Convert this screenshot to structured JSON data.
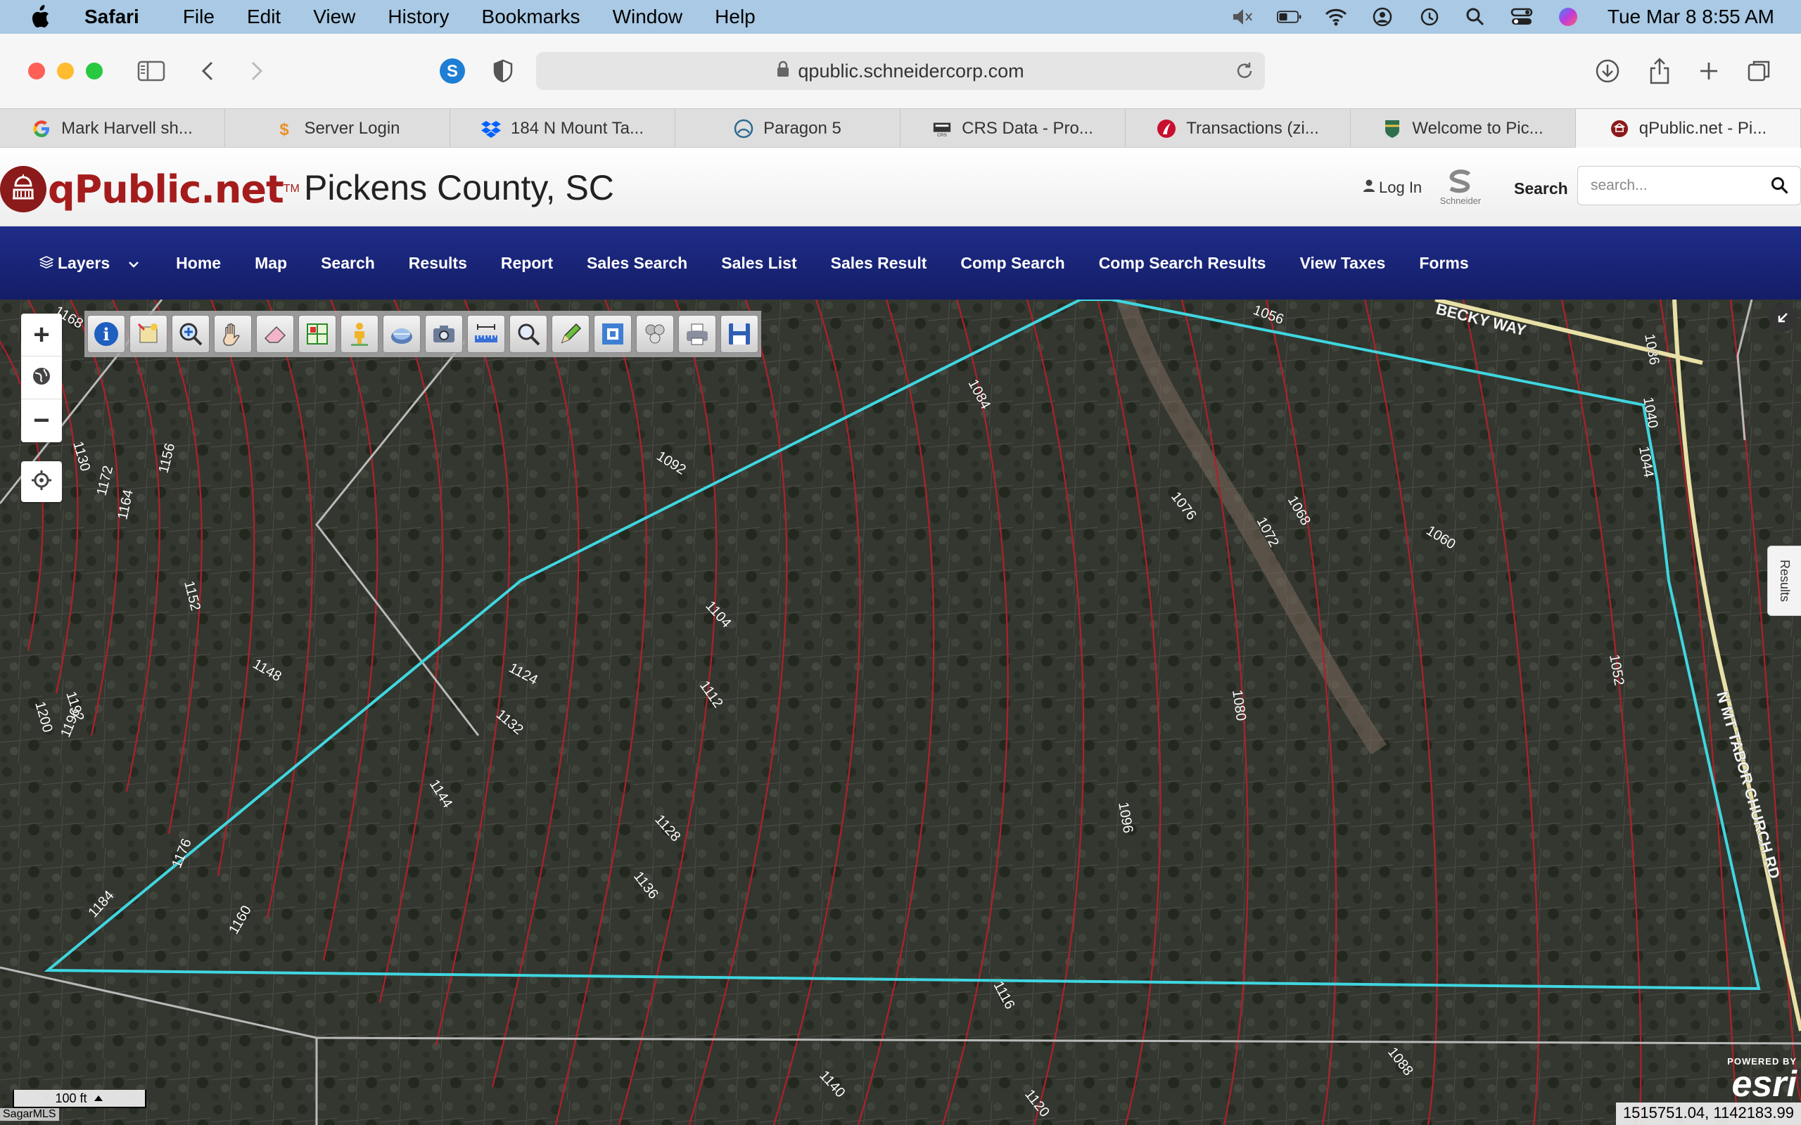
{
  "menubar": {
    "app": "Safari",
    "items": [
      "File",
      "Edit",
      "View",
      "History",
      "Bookmarks",
      "Window",
      "Help"
    ],
    "clock": "Tue Mar 8  8:55 AM"
  },
  "browser": {
    "url": "qpublic.schneidercorp.com",
    "tabs": [
      {
        "label": "Mark Harvell sh...",
        "icon": "google-icon"
      },
      {
        "label": "Server Login",
        "icon": "dollar-icon"
      },
      {
        "label": "184 N Mount Ta...",
        "icon": "dropbox-icon"
      },
      {
        "label": "Paragon 5",
        "icon": "paragon-icon"
      },
      {
        "label": "CRS Data - Pro...",
        "icon": "crs-icon"
      },
      {
        "label": "Transactions (zi...",
        "icon": "zipform-icon"
      },
      {
        "label": "Welcome to Pic...",
        "icon": "county-seal-icon"
      },
      {
        "label": "qPublic.net - Pi...",
        "icon": "qpublic-icon"
      }
    ]
  },
  "site": {
    "brand": "qPublic.net",
    "trademark": "TM",
    "county": "Pickens County, SC",
    "login": "Log In",
    "schneider": "Schneider",
    "search_label": "Search",
    "search_placeholder": "search..."
  },
  "nav": {
    "layers": "Layers",
    "items": [
      "Home",
      "Map",
      "Search",
      "Results",
      "Report",
      "Sales Search",
      "Sales List",
      "Sales Result",
      "Comp Search",
      "Comp Search Results",
      "View Taxes",
      "Forms"
    ]
  },
  "map": {
    "zoom_in": "+",
    "zoom_out": "−",
    "tools": [
      "info-icon",
      "identify-icon",
      "zoom-in-tool-icon",
      "pan-hand-icon",
      "eraser-icon",
      "select-parcels-icon",
      "pegman-icon",
      "globe-tool-icon",
      "camera-icon",
      "measure-icon",
      "search-tool-icon",
      "pencil-icon",
      "buffer-icon",
      "stack-icon",
      "print-icon",
      "save-icon"
    ],
    "results_tab": "Results",
    "scale": "100 ft",
    "coordinates": "1515751.04, 1142183.99",
    "esri_powered": "POWERED BY",
    "esri_word": "esri",
    "watermark": "SagarMLS",
    "road_labels": [
      "BECKY WAY",
      "N MT TABOR CHURCH RD"
    ],
    "contour_labels": [
      "1056",
      "1036",
      "1040",
      "1044",
      "1084",
      "1092",
      "1076",
      "1068",
      "1072",
      "1060",
      "1104",
      "1124",
      "1112",
      "1080",
      "1052",
      "1132",
      "1144",
      "1128",
      "1096",
      "1136",
      "1176",
      "1184",
      "1160",
      "1116",
      "1140",
      "1120",
      "1088",
      "1148",
      "1152",
      "1156",
      "1172",
      "1164",
      "1130",
      "1200",
      "1192",
      "1196",
      "1168"
    ]
  },
  "colors": {
    "nav_bg": "#1a2479",
    "brand_red": "#a51c1c",
    "parcel_outline": "#40d6e0",
    "contour": "#b0202a"
  }
}
